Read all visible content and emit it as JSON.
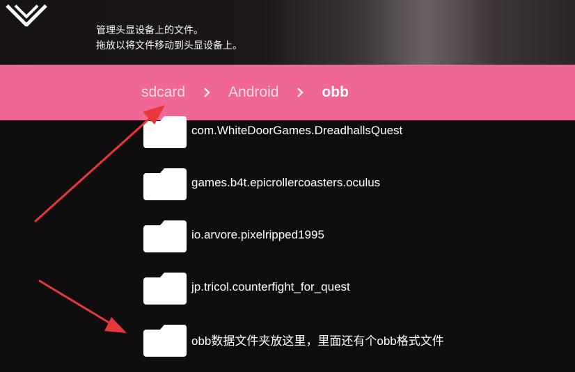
{
  "header": {
    "info_line1": "管理头显设备上的文件。",
    "info_line2": "拖放以将文件移动到头显设备上。"
  },
  "breadcrumb": {
    "items": [
      {
        "label": "sdcard"
      },
      {
        "label": "Android"
      },
      {
        "label": "obb"
      }
    ]
  },
  "files": [
    {
      "name": "com.WhiteDoorGames.DreadhallsQuest",
      "icon": "folder-icon"
    },
    {
      "name": "games.b4t.epicrollercoasters.oculus",
      "icon": "folder-icon"
    },
    {
      "name": "io.arvore.pixelripped1995",
      "icon": "folder-icon"
    },
    {
      "name": "jp.tricol.counterfight_for_quest",
      "icon": "folder-icon"
    },
    {
      "name": "obb数据文件夹放这里，里面还有个obb格式文件",
      "icon": "folder-icon"
    }
  ],
  "colors": {
    "breadcrumb_bg": "#f06795",
    "annotation_arrow": "#e8373b",
    "background": "#0f0d0e"
  }
}
